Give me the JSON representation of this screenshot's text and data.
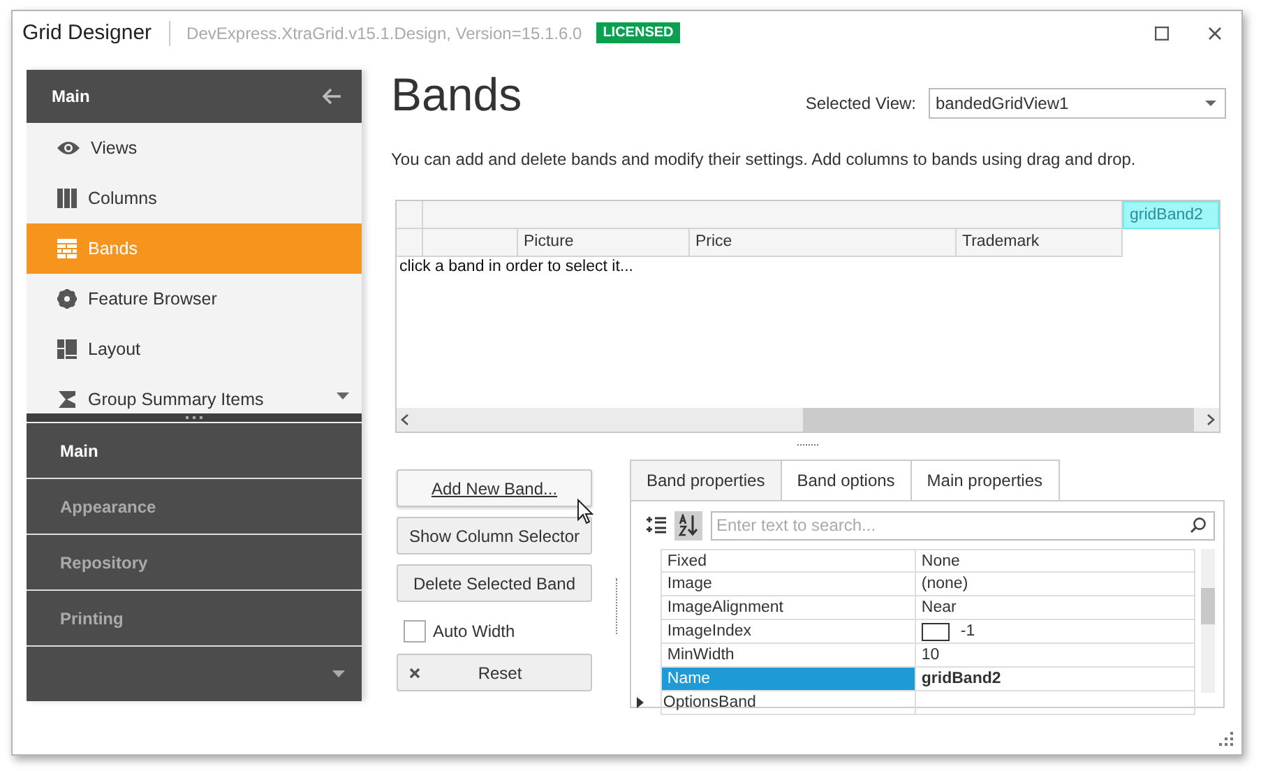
{
  "window": {
    "title": "Grid Designer",
    "subtitle": "DevExpress.XtraGrid.v15.1.Design, Version=15.1.6.0",
    "badge": "LICENSED"
  },
  "sidebar": {
    "header": "Main",
    "items": [
      {
        "label": "Views",
        "selected": false
      },
      {
        "label": "Columns",
        "selected": false
      },
      {
        "label": "Bands",
        "selected": true
      },
      {
        "label": "Feature Browser",
        "selected": false
      },
      {
        "label": "Layout",
        "selected": false
      },
      {
        "label": "Group Summary Items",
        "selected": false
      }
    ],
    "groups": [
      {
        "label": "Main",
        "selected": true
      },
      {
        "label": "Appearance",
        "selected": false
      },
      {
        "label": "Repository",
        "selected": false
      },
      {
        "label": "Printing",
        "selected": false
      }
    ]
  },
  "page": {
    "title": "Bands",
    "selected_view_label": "Selected View:",
    "selected_view": "bandedGridView1",
    "description": "You can add and delete bands and modify their settings. Add columns to bands using drag and drop."
  },
  "grid": {
    "band": "gridBand2",
    "band_selected": true,
    "columns": [
      "Picture",
      "Price",
      "Trademark"
    ],
    "hint": "click a band in order to select it..."
  },
  "buttons": [
    {
      "label": "Add New Band...",
      "hovered": true
    },
    {
      "label": "Show Column Selector",
      "hovered": false
    },
    {
      "label": "Delete Selected Band",
      "hovered": false
    }
  ],
  "auto_width": {
    "label": "Auto Width",
    "checked": false
  },
  "reset_button": {
    "label": "Reset"
  },
  "tabs": [
    {
      "label": "Band properties",
      "selected": true
    },
    {
      "label": "Band options",
      "selected": false
    },
    {
      "label": "Main properties",
      "selected": false
    }
  ],
  "properties": {
    "view_modes": [
      {
        "selected": false
      },
      {
        "selected": true
      }
    ],
    "search_placeholder": "Enter text to search...",
    "rows": [
      {
        "name": "Fixed",
        "value": "None",
        "kind": "text",
        "selected": false
      },
      {
        "name": "Image",
        "value": "(none)",
        "kind": "text",
        "selected": false
      },
      {
        "name": "ImageAlignment",
        "value": "Near",
        "kind": "text",
        "selected": false
      },
      {
        "name": "ImageIndex",
        "value": "-1",
        "kind": "image",
        "selected": false
      },
      {
        "name": "MinWidth",
        "value": "10",
        "kind": "text",
        "selected": false
      },
      {
        "name": "Name",
        "value": "gridBand2",
        "kind": "text",
        "selected": true
      },
      {
        "name": "OptionsBand",
        "kind": "group",
        "selected": false
      }
    ]
  }
}
